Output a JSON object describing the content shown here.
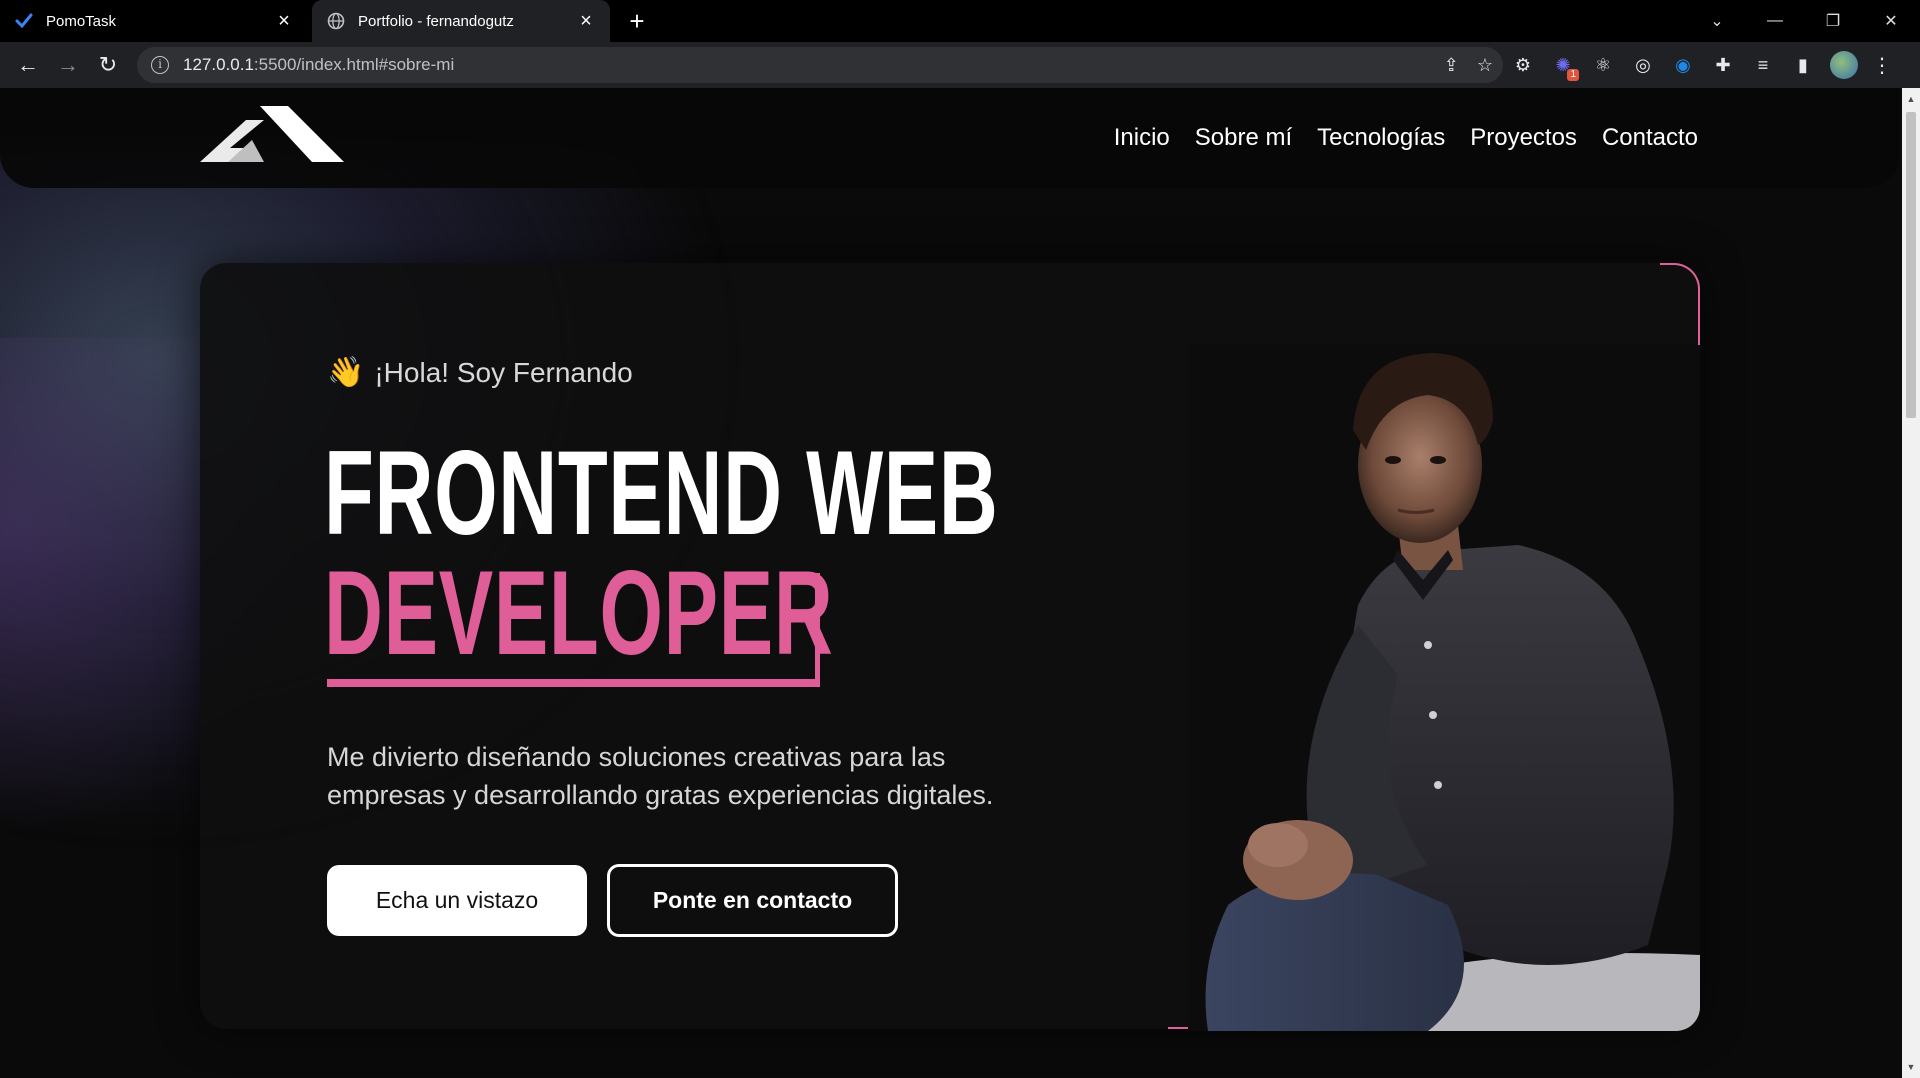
{
  "browser": {
    "tabs": [
      {
        "title": "PomoTask",
        "icon": "checkmark-icon",
        "active": false
      },
      {
        "title": "Portfolio - fernandogutz",
        "icon": "globe-icon",
        "active": true
      }
    ],
    "url_host": "127.0.0.1",
    "url_rest": ":5500/index.html#sobre-mi",
    "extension_badge": "1"
  },
  "site": {
    "nav": [
      "Inicio",
      "Sobre mí",
      "Tecnologías",
      "Proyectos",
      "Contacto"
    ],
    "hero": {
      "greeting_emoji": "👋",
      "greeting": "¡Hola! Soy Fernando",
      "title_line1": "FRONTEND WEB",
      "title_line2": "DEVELOPER",
      "description": "Me divierto diseñando soluciones creativas para las empresas y desarrollando gratas experiencias digitales.",
      "primary_button": "Echa un vistazo",
      "secondary_button": "Ponte en contacto"
    },
    "colors": {
      "accent": "#df5e97",
      "background": "#0a0a0a"
    }
  }
}
